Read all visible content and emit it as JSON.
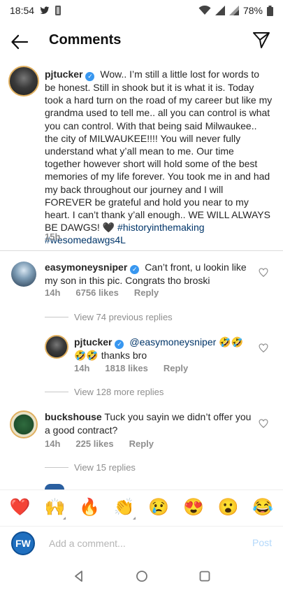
{
  "status_bar": {
    "time": "18:54",
    "battery": "78%"
  },
  "header": {
    "title": "Comments"
  },
  "caption": {
    "username": "pjtucker",
    "text": "Wow.. I’m still a little lost for words to be honest. Still in shook but it is what it is. Today took a hard turn on the road of my career but like my grandma used to tell me.. all you can control is what you can control. With that being said Milwaukee.. the city of MILWAUKEE!!!! You will never fully understand what y’all mean to me. Our time together however short will hold some of the best memories of my life forever. You took me in and had my back throughout our journey and I will FOREVER be grateful and hold you near to my heart. I can’t thank y’all enough.. WE WILL ALWAYS BE DAWGS! 🖤",
    "hashtags": "#historyinthemaking #wesomedawgs4L",
    "time": "15h"
  },
  "comments": [
    {
      "username": "easymoneysniper",
      "text": "Can’t front, u lookin like my son in this pic. Congrats tho broski",
      "time": "14h",
      "likes": "6756 likes",
      "reply": "Reply",
      "view_replies": "View 74 previous replies"
    },
    {
      "username": "pjtucker",
      "mention": "@easymoneysniper",
      "text": "🤣🤣 thanks bro",
      "time": "14h",
      "likes": "1818 likes",
      "reply": "Reply",
      "view_replies": "View 128 more replies"
    },
    {
      "username": "buckshouse",
      "text": "Tuck you sayin we didn’t offer you a good contract?",
      "time": "14h",
      "likes": "225 likes",
      "reply": "Reply",
      "view_replies": "View 15 replies"
    }
  ],
  "reactions": [
    "❤️",
    "🙌",
    "🔥",
    "👏",
    "😢",
    "😍",
    "😮",
    "😂"
  ],
  "composer": {
    "avatar_text": "FW",
    "placeholder": "Add a comment...",
    "post_label": "Post"
  },
  "colors": {
    "link": "#003569",
    "meta": "#8e8e8e",
    "post_disabled": "#b3d8fb",
    "verified": "#3897f0"
  }
}
